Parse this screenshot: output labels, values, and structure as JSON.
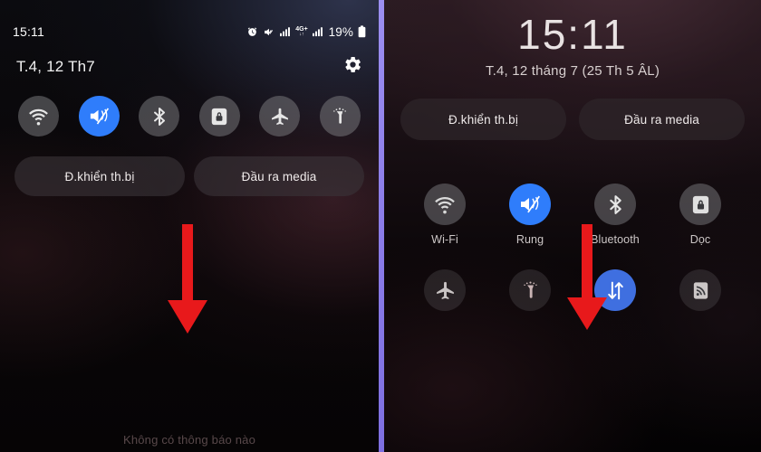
{
  "meta": {
    "accent_blue": "#2f7dfb",
    "arrow_red": "#e8191b",
    "divider_purple": "#9c8ff0",
    "toggle_off_bg": "#76767a"
  },
  "left_panel": {
    "status_bar": {
      "clock": "15:11",
      "battery_percent": "19%",
      "network_label": "4G+",
      "icons": [
        "alarm-icon",
        "mute-icon",
        "signal-bars-icon",
        "network-4gplus-icon",
        "signal-bars-icon",
        "battery-icon"
      ]
    },
    "date": "T.4, 12 Th7",
    "settings_icon": "gear-icon",
    "toggles": [
      {
        "name": "wifi",
        "icon": "wifi-icon",
        "active": false
      },
      {
        "name": "vibrate",
        "icon": "vibrate-icon",
        "active": true
      },
      {
        "name": "bluetooth",
        "icon": "bluetooth-icon",
        "active": false
      },
      {
        "name": "lock",
        "icon": "lock-icon",
        "active": false
      },
      {
        "name": "airplane",
        "icon": "airplane-icon",
        "active": false
      },
      {
        "name": "flashlight",
        "icon": "flashlight-icon",
        "active": false
      }
    ],
    "buttons": [
      {
        "label": "Đ.khiển th.bị"
      },
      {
        "label": "Đầu ra media"
      }
    ],
    "empty_notifications": "Không có thông báo nào",
    "arrow": {
      "name": "down-arrow-annotation",
      "color": "#e8191b"
    }
  },
  "right_panel": {
    "clock": "15:11",
    "date": "T.4, 12 tháng 7 (25 Th 5 ÂL)",
    "buttons": [
      {
        "label": "Đ.khiển th.bị"
      },
      {
        "label": "Đầu ra media"
      }
    ],
    "toggles_labeled": [
      {
        "label": "Wi-Fi",
        "icon": "wifi-icon",
        "active": false
      },
      {
        "label": "Rung",
        "icon": "vibrate-icon",
        "active": true
      },
      {
        "label": "Bluetooth",
        "icon": "bluetooth-icon",
        "active": false
      },
      {
        "label": "Dọc",
        "icon": "lock-icon",
        "active": false
      }
    ],
    "toggles_bottom": [
      {
        "name": "airplane",
        "icon": "airplane-icon",
        "active": false
      },
      {
        "name": "flashlight",
        "icon": "flashlight-icon",
        "active": false
      },
      {
        "name": "mobile-data",
        "icon": "data-arrows-icon",
        "active": true
      },
      {
        "name": "smart-view",
        "icon": "cast-icon",
        "active": false
      }
    ],
    "arrow": {
      "name": "down-arrow-annotation",
      "color": "#e8191b"
    }
  }
}
